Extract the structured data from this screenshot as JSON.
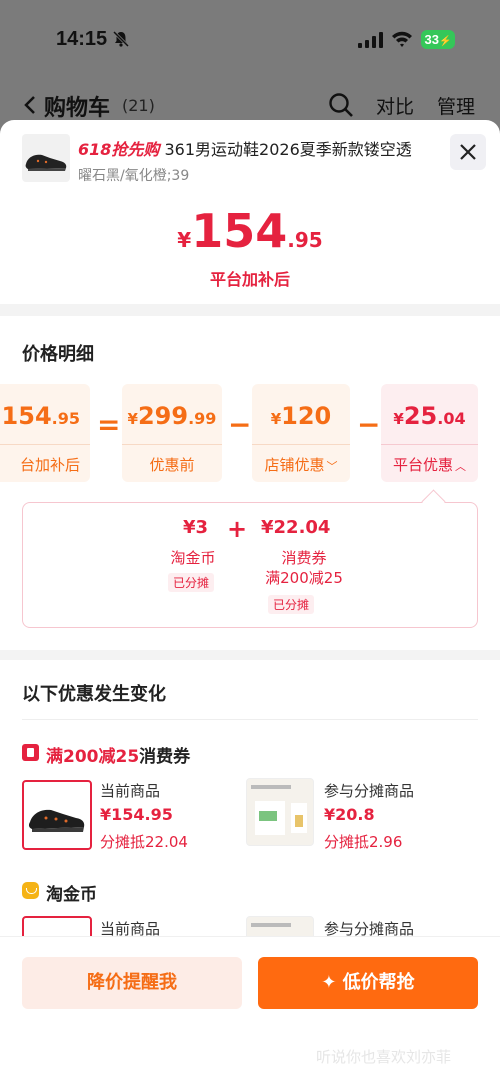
{
  "status_bar": {
    "time": "14:15",
    "battery": "33"
  },
  "cart_header": {
    "title": "购物车",
    "count": "(21)",
    "compare": "对比",
    "manage": "管理"
  },
  "product": {
    "promo_tag": "618抢先购",
    "title": "361男运动鞋2026夏季新款镂空透",
    "variant": "曜石黑/氧化橙;39",
    "price_currency": "¥",
    "price_int": "154",
    "price_dec": ".95",
    "price_note": "平台加补后"
  },
  "price_detail": {
    "title": "价格明细",
    "final": {
      "int": "154",
      "dec": ".95",
      "label": "台加补后"
    },
    "equals": "=",
    "original": {
      "currency": "¥",
      "int": "299",
      "dec": ".99",
      "label": "优惠前"
    },
    "store": {
      "currency": "¥",
      "int": "120",
      "label": "店铺优惠"
    },
    "platform": {
      "currency": "¥",
      "int": "25",
      "dec": ".04",
      "label": "平台优惠"
    },
    "minus": "−",
    "breakdown": {
      "coin_value": "¥3",
      "coin_label": "淘金币",
      "coin_chip": "已分摊",
      "plus": "+",
      "coupon_value": "¥22.04",
      "coupon_label": "消费券",
      "coupon_rule": "满200减25",
      "coupon_chip": "已分摊"
    }
  },
  "changes": {
    "title": "以下优惠发生变化",
    "coupon_section": {
      "red_text": "满200减25",
      "text": "消费券",
      "current": {
        "label": "当前商品",
        "price": "¥154.95",
        "share": "分摊抵22.04"
      },
      "other": {
        "label": "参与分摊商品",
        "price": "¥20.8",
        "share": "分摊抵2.96"
      }
    },
    "coin_section": {
      "text": "淘金币",
      "current": {
        "label": "当前商品"
      },
      "other": {
        "label": "参与分摊商品"
      }
    }
  },
  "buttons": {
    "remind": "降价提醒我",
    "grab": "✦ 低价帮抢"
  },
  "watermark": "听说你也喜欢刘亦菲"
}
